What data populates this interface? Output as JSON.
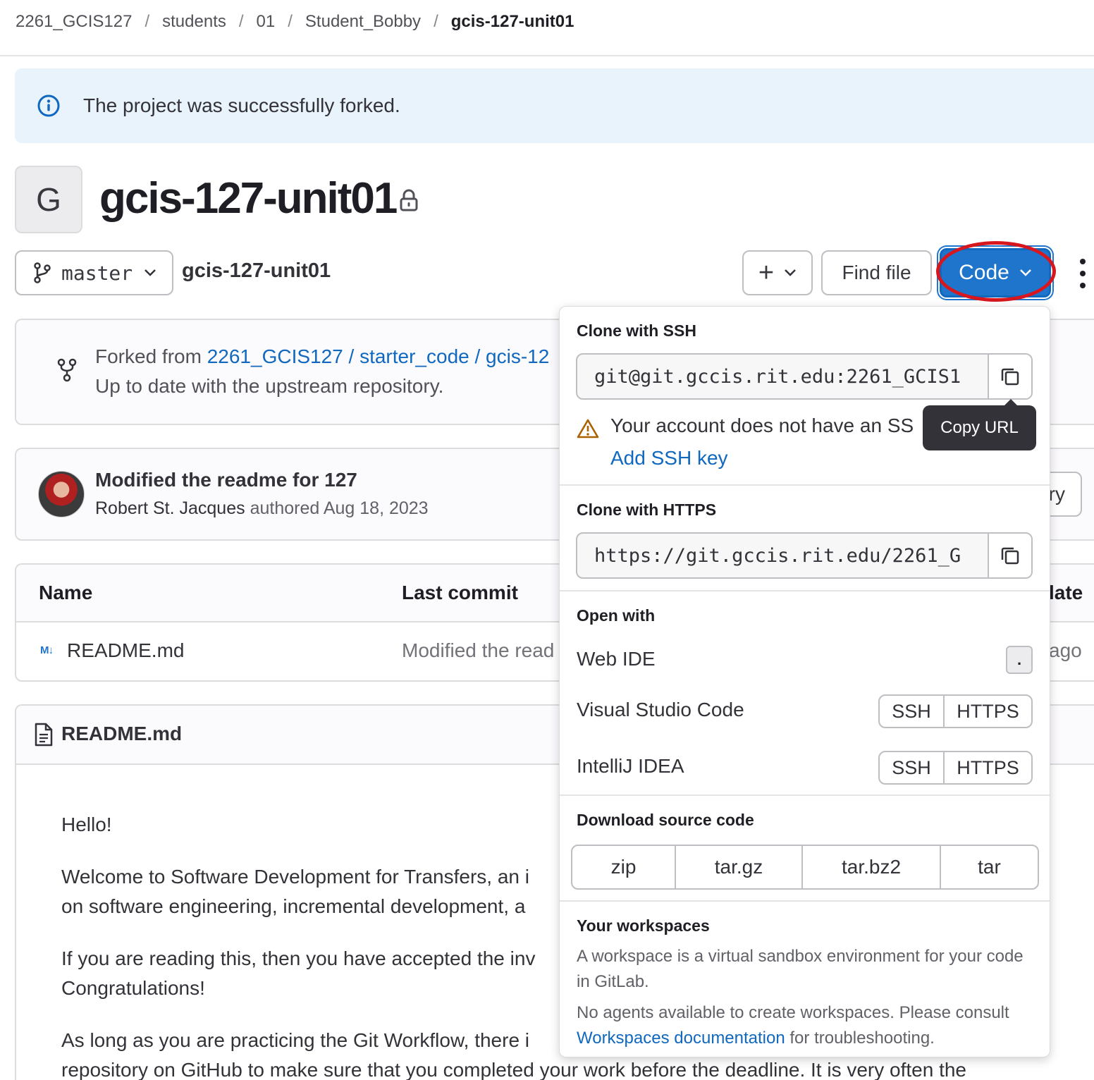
{
  "breadcrumb": {
    "items": [
      "2261_GCIS127",
      "students",
      "01",
      "Student_Bobby"
    ],
    "current": "gcis-127-unit01",
    "separator": "/"
  },
  "alert": {
    "message": "The project was successfully forked.",
    "icon": "info-icon"
  },
  "project": {
    "avatar_letter": "G",
    "title": "gcis-127-unit01",
    "visibility_icon": "lock-icon"
  },
  "toolbar": {
    "branch": "master",
    "path": "gcis-127-unit01",
    "add_label": "+",
    "find_file_label": "Find file",
    "code_label": "Code"
  },
  "fork": {
    "prefix": "Forked from ",
    "source": "2261_GCIS127 / starter_code / gcis-12",
    "status": "Up to date with the upstream repository."
  },
  "commit": {
    "title": "Modified the readme for 127",
    "author": "Robert St. Jacques",
    "meta": " authored Aug 18, 2023",
    "history_label": "ry"
  },
  "file_table": {
    "headers": {
      "name": "Name",
      "last_commit": "Last commit",
      "date": "late"
    },
    "rows": [
      {
        "icon": "M↓",
        "name": "README.md",
        "commit": "Modified the read",
        "date": "ago"
      }
    ]
  },
  "readme": {
    "title": "README.md",
    "paragraphs": [
      "Hello!",
      "Welcome to Software Development for Transfers, an i",
      "on software engineering, incremental development, a",
      "If you are reading this, then you have accepted the inv",
      "Congratulations!",
      "As long as you are practicing the Git Workflow, there i",
      "repository on GitHub to make sure that you completed your work before the deadline. It is very often the"
    ]
  },
  "code_dropdown": {
    "ssh": {
      "heading": "Clone with SSH",
      "url": "git@git.gccis.rit.edu:2261_GCIS1",
      "warning": "Your account does not have an SS",
      "add_key": "Add SSH key"
    },
    "https": {
      "heading": "Clone with HTTPS",
      "url": "https://git.gccis.rit.edu/2261_G"
    },
    "open_with": {
      "heading": "Open with",
      "web_ide": "Web IDE",
      "web_ide_shortcut": ".",
      "vscode": "Visual Studio Code",
      "intellij": "IntelliJ IDEA",
      "ssh": "SSH",
      "https": "HTTPS"
    },
    "download": {
      "heading": "Download source code",
      "formats": [
        "zip",
        "tar.gz",
        "tar.bz2",
        "tar"
      ]
    },
    "workspaces": {
      "heading": "Your workspaces",
      "description": "A workspace is a virtual sandbox environment for your code in GitLab.",
      "note_prefix": "No agents available to create workspaces. Please consult ",
      "note_link": "Workspaces documentation",
      "note_suffix": " for troubleshooting."
    }
  },
  "tooltip": {
    "text": "Copy URL"
  },
  "colors": {
    "accent": "#1f75cb",
    "link": "#1068bf",
    "alert_bg": "#e9f3fc",
    "highlight": "#d8161e"
  }
}
